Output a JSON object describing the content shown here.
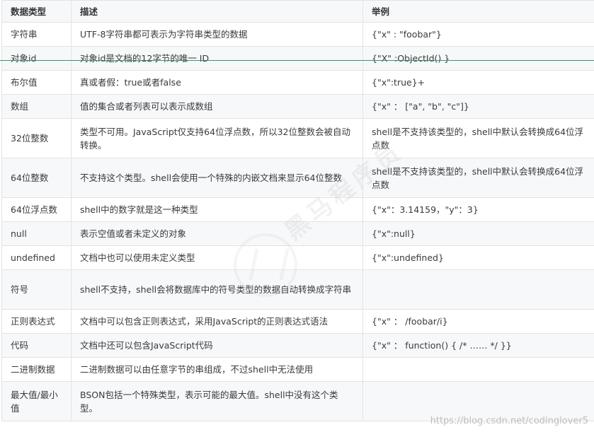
{
  "table": {
    "headers": [
      "数据类型",
      "描述",
      "举例"
    ],
    "rows": [
      {
        "type": "字符串",
        "desc": "UTF-8字符串都可表示为字符串类型的数据",
        "example": "{\"x\" : \"foobar\"}"
      },
      {
        "type": "对象id",
        "desc": "对象id是文档的12字节的唯一 ID",
        "example": "{\"X\" :ObjectId() }"
      },
      {
        "type": "布尔值",
        "desc": "真或者假：true或者false",
        "example": "{\"x\":true}+"
      },
      {
        "type": "数组",
        "desc": "值的集合或者列表可以表示成数组",
        "example": "{\"x\" ： [\"a\", \"b\", \"c\"]}"
      },
      {
        "type": "32位整数",
        "desc": "类型不可用。JavaScript仅支持64位浮点数，所以32位整数会被自动转换。",
        "example": "shell是不支持该类型的，shell中默认会转换成64位浮点数"
      },
      {
        "type": "64位整数",
        "desc": "不支持这个类型。shell会使用一个特殊的内嵌文档来显示64位整数",
        "example": "shell是不支持该类型的，shell中默认会转换成64位浮点数"
      },
      {
        "type": "64位浮点数",
        "desc": "shell中的数字就是这一种类型",
        "example": "{\"x\"：3.14159，\"y\"：3}"
      },
      {
        "type": "null",
        "desc": "表示空值或者未定义的对象",
        "example": "{\"x\":null}"
      },
      {
        "type": "undefined",
        "desc": "文档中也可以使用未定义类型",
        "example": "{\"x\":undefined}"
      },
      {
        "type": "符号",
        "desc": "shell不支持，shell会将数据库中的符号类型的数据自动转换成字符串",
        "example": ""
      },
      {
        "type": "正则表达式",
        "desc": "文档中可以包含正则表达式，采用JavaScript的正则表达式语法",
        "example": "{\"x\" ： /foobar/i}"
      },
      {
        "type": "代码",
        "desc": "文档中还可以包含JavaScript代码",
        "example": "{\"x\" ： function() { /* …… */ }}"
      },
      {
        "type": "二进制数据",
        "desc": "二进制数据可以由任意字节的串组成，不过shell中无法使用",
        "example": ""
      },
      {
        "type": "最大值/最小值",
        "desc": "BSON包括一个特殊类型，表示可能的最大值。shell中没有这个类型。",
        "example": ""
      }
    ]
  },
  "watermark_text": "黑马程序员",
  "csdn_watermark": "https://blog.csdn.net/codinglover5",
  "colors": {
    "border": "#e3e3e3",
    "stripe": "#f7f8fa",
    "accent_line": "#2f9c68",
    "text": "#333333"
  }
}
